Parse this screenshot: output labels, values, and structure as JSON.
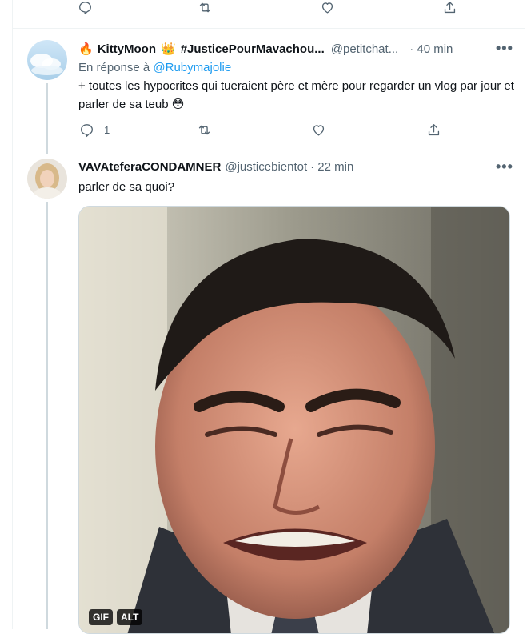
{
  "top_actions": {
    "reply_count": "",
    "retweet_count": "",
    "like_count": ""
  },
  "tweet1": {
    "name_emoji": "🔥",
    "name": "KittyMoon",
    "crown_emoji": "👑",
    "hashtag": "#JusticePourMavachou...",
    "handle": "@petitchat...",
    "time": "· 40 min",
    "reply_prefix": "En réponse à",
    "reply_user": "@Rubymajolie",
    "text": "+ toutes les hypocrites qui tueraient père et mère pour regarder un vlog par jour et parler de sa teub",
    "text_emoji": "😳",
    "reply_count": "1",
    "retweet_count": "",
    "like_count": ""
  },
  "tweet2": {
    "name": "VAVAteferaCONDAMNER",
    "handle": "@justicebientot",
    "time": "· 22 min",
    "text": "parler de sa quoi?",
    "media_badges": {
      "gif": "GIF",
      "alt": "ALT"
    }
  },
  "more_label": "•••",
  "colors": {
    "link": "#1d9bf0",
    "secondary_text": "#536471",
    "border": "#eff3f4"
  }
}
